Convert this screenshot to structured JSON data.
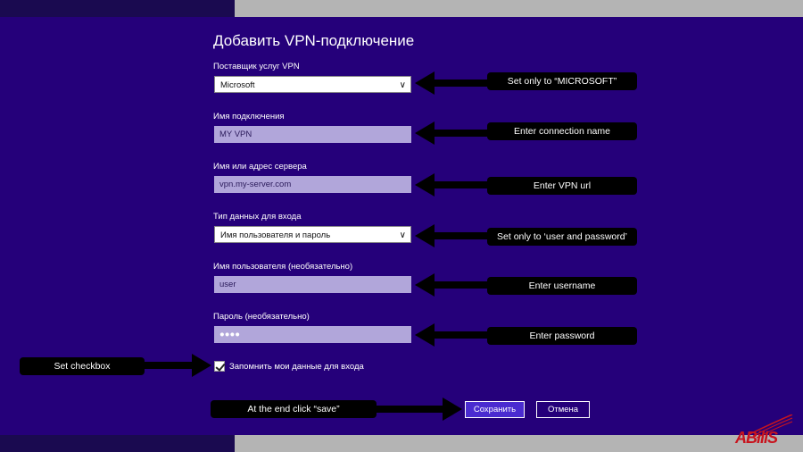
{
  "dialog": {
    "title": "Добавить VPN-подключение",
    "provider_label": "Поставщик услуг VPN",
    "provider_value": "Microsoft",
    "connection_name_label": "Имя подключения",
    "connection_name_value": "MY VPN",
    "server_label": "Имя или адрес сервера",
    "server_value": "vpn.my-server.com",
    "signin_type_label": "Тип данных для входа",
    "signin_type_value": "Имя пользователя и пароль",
    "username_label": "Имя пользователя (необязательно)",
    "username_value": "user",
    "password_label": "Пароль (необязательно)",
    "password_value": "●●●●",
    "remember_label": "Запомнить мои данные для входа",
    "remember_checked": true,
    "save_label": "Сохранить",
    "cancel_label": "Отмена"
  },
  "annotations": {
    "provider": "Set only to “MICROSOFT”",
    "connection_name": "Enter connection name",
    "server": "Enter VPN url",
    "signin_type": "Set only to ‘user and password’",
    "username": "Enter username",
    "password": "Enter password",
    "checkbox": "Set checkbox",
    "save": "At the end click “save”"
  },
  "logo": {
    "text": "ABillS"
  },
  "colors": {
    "background": "#25007a",
    "field": "#b1a6da",
    "save_button": "#4a2bd0",
    "logo": "#c8141e"
  }
}
